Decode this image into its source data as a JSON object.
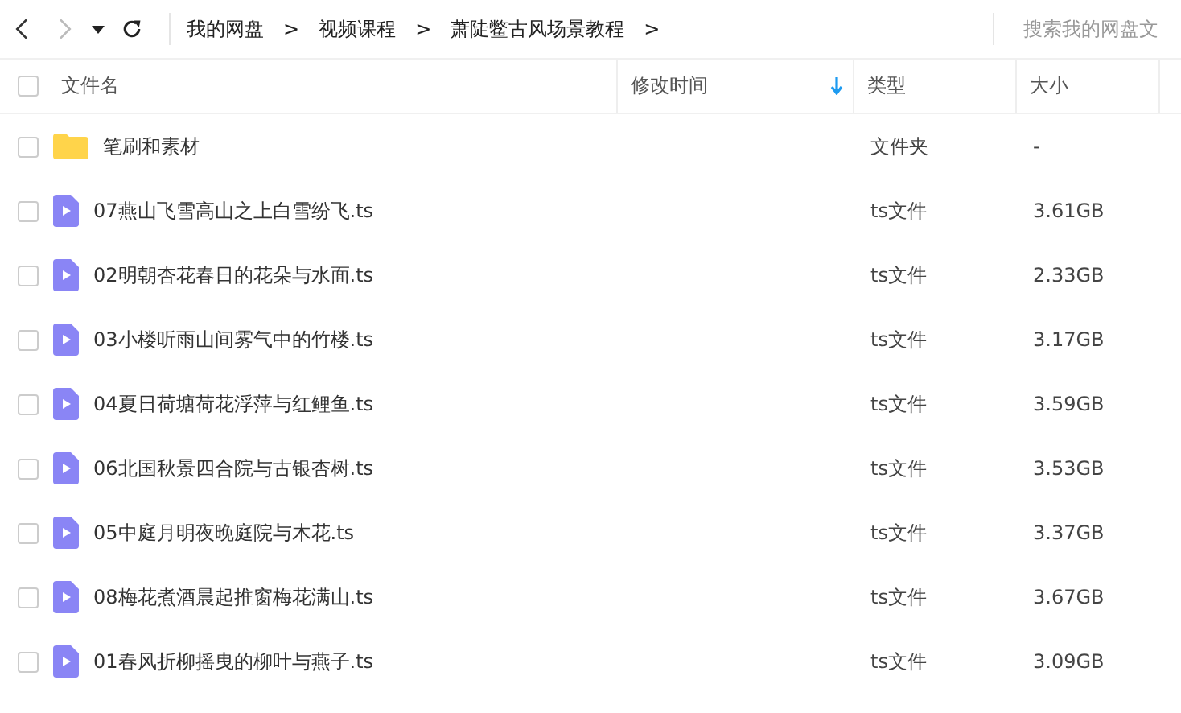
{
  "toolbar": {
    "breadcrumb": [
      "我的网盘",
      "视频课程",
      "萧陡鳖古风场景教程"
    ],
    "separator": ">",
    "search": {
      "placeholder": "搜索我的网盘文"
    }
  },
  "table": {
    "select_all": {
      "checked": false
    },
    "columns": [
      "文件名",
      "修改时间",
      "类型",
      "大小"
    ],
    "rows": [
      {
        "kind": "folder",
        "checked": false,
        "name": "笔刷和素材",
        "type": "文件夹",
        "size": "-"
      },
      {
        "kind": "video",
        "checked": false,
        "name": "07燕山飞雪高山之上白雪纷飞.ts",
        "type": "ts文件",
        "size": "3.61GB"
      },
      {
        "kind": "video",
        "checked": false,
        "name": "02明朝杏花春日的花朵与水面.ts",
        "type": "ts文件",
        "size": "2.33GB"
      },
      {
        "kind": "video",
        "checked": false,
        "name": "03小楼听雨山间雾气中的竹楼.ts",
        "type": "ts文件",
        "size": "3.17GB"
      },
      {
        "kind": "video",
        "checked": false,
        "name": "04夏日荷塘荷花浮萍与红鲤鱼.ts",
        "type": "ts文件",
        "size": "3.59GB"
      },
      {
        "kind": "video",
        "checked": false,
        "name": "06北国秋景四合院与古银杏树.ts",
        "type": "ts文件",
        "size": "3.53GB"
      },
      {
        "kind": "video",
        "checked": false,
        "name": "05中庭月明夜晚庭院与木花.ts",
        "type": "ts文件",
        "size": "3.37GB"
      },
      {
        "kind": "video",
        "checked": false,
        "name": "08梅花煮酒晨起推窗梅花满山.ts",
        "type": "ts文件",
        "size": "3.67GB"
      },
      {
        "kind": "video",
        "checked": false,
        "name": "01春风折柳摇曳的柳叶与燕子.ts",
        "type": "ts文件",
        "size": "3.09GB"
      }
    ]
  }
}
